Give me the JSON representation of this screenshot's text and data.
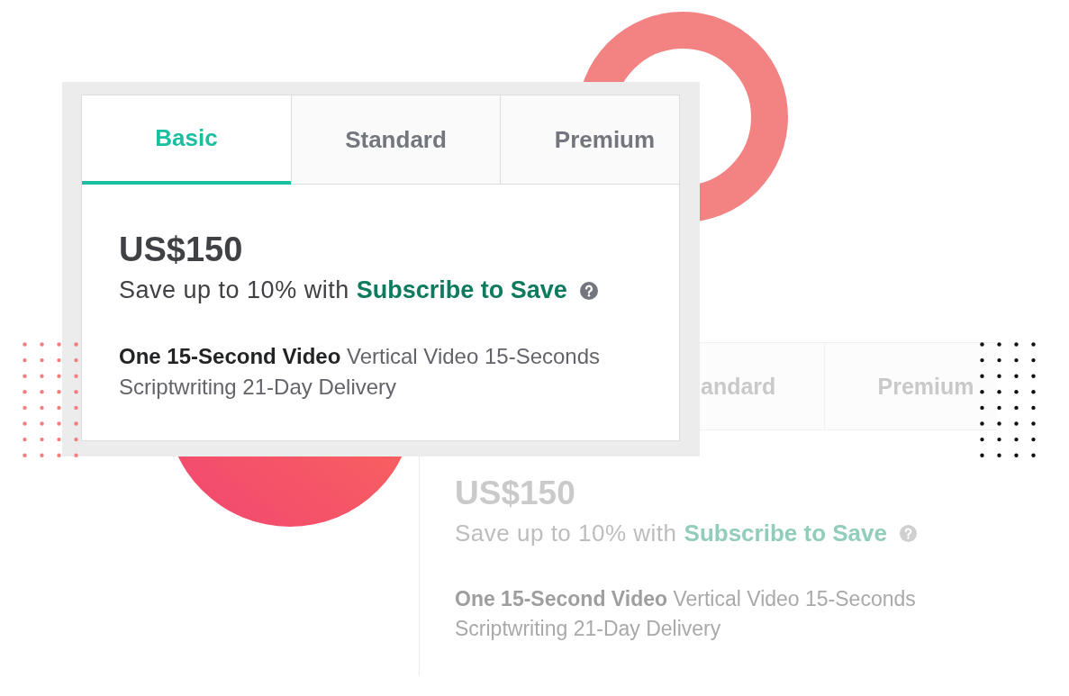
{
  "cards": [
    {
      "kind": "front",
      "tabs": [
        {
          "label": "Basic",
          "selected": true
        },
        {
          "label": "Standard",
          "selected": false
        },
        {
          "label": "Premium",
          "selected": false
        }
      ],
      "price": "US$150",
      "savings": {
        "text": "Save up to 10% with",
        "link": "Subscribe to Save"
      },
      "features": "**One 15-Second Video** Vertical Video 15-Seconds Scriptwriting 21-Day Delivery"
    },
    {
      "kind": "faded",
      "tabs": [
        {
          "label": "andard",
          "selected": false
        },
        {
          "label": "Premium",
          "selected": false
        }
      ],
      "price": "US$150",
      "savings": {
        "text": "Save up to 10% with",
        "link": "Subscribe to Save"
      },
      "features": "**One 15-Second Video** Vertical Video 15-Seconds Scriptwriting 21-Day Delivery"
    }
  ]
}
